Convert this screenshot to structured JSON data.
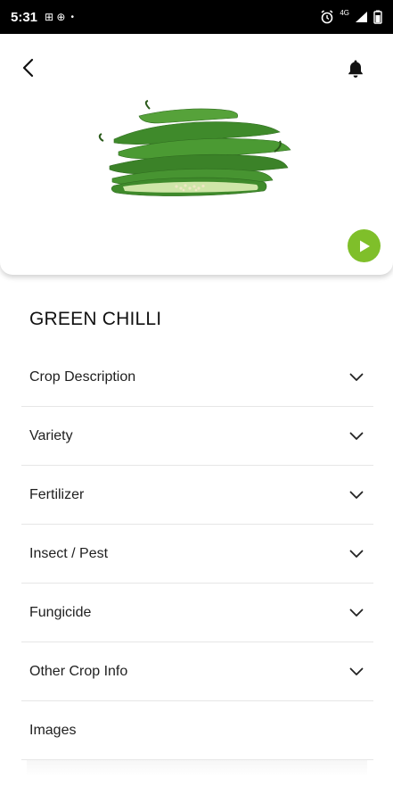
{
  "status_bar": {
    "time": "5:31",
    "sim_icons": "⊞ ⊕",
    "dot": "•",
    "network": "4G"
  },
  "crop": {
    "name": "GREEN CHILLI"
  },
  "sections": [
    {
      "label": "Crop Description",
      "icon": "chevron-down-icon"
    },
    {
      "label": "Variety",
      "icon": "chevron-down-icon"
    },
    {
      "label": "Fertilizer",
      "icon": "chevron-down-icon"
    },
    {
      "label": "Insect / Pest",
      "icon": "chevron-down-icon"
    },
    {
      "label": "Fungicide",
      "icon": "chevron-down-icon"
    },
    {
      "label": "Other Crop Info",
      "icon": "chevron-down-icon"
    }
  ],
  "images_section": {
    "label": "Images"
  },
  "colors": {
    "accent": "#7fbf2a",
    "status_bar": "#000000"
  }
}
